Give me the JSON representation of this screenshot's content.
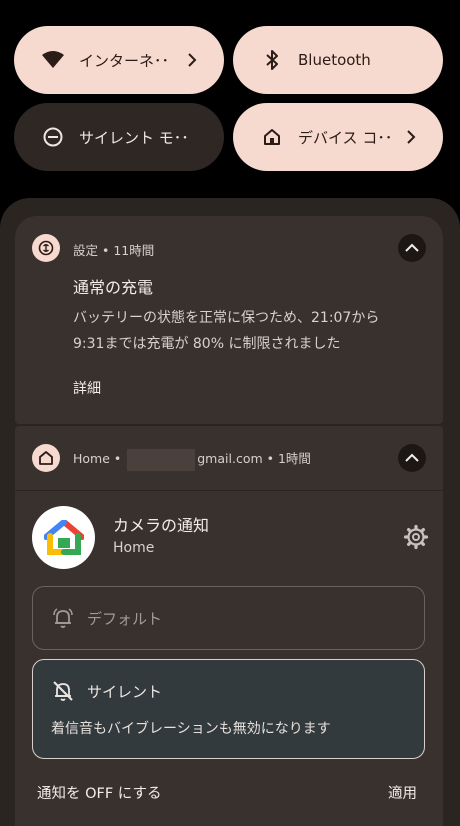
{
  "quick_settings": {
    "internet": {
      "label": "インターネ･･",
      "icon": "wifi-icon"
    },
    "bluetooth": {
      "label": "Bluetooth",
      "icon": "bluetooth-icon"
    },
    "dnd": {
      "label": "サイレント モ･･",
      "icon": "do-not-disturb-icon"
    },
    "device_controls": {
      "label": "デバイス コ･･",
      "icon": "home-icon"
    }
  },
  "notification_settings": {
    "app": "設定",
    "time": "11時間",
    "title": "通常の充電",
    "body_line1": "バッテリーの状態を正常に保つため、21:07から",
    "body_line2": "9:31までは充電が 80% に制限されました",
    "action": "詳細"
  },
  "notification_home": {
    "app": "Home",
    "account_suffix": "gmail.com",
    "time": "1時間",
    "title": "カメラの通知",
    "subtitle": "Home",
    "option_default": "デフォルト",
    "option_silent": "サイレント",
    "option_silent_desc": "着信音もバイブレーションも無効になります",
    "turn_off": "通知を OFF にする",
    "apply": "適用"
  },
  "colors": {
    "tile_on": "#f6d9cf",
    "tile_off": "#2e2723",
    "shade": "#2b2522",
    "card": "#39312e",
    "selected_option": "#333a3d"
  }
}
